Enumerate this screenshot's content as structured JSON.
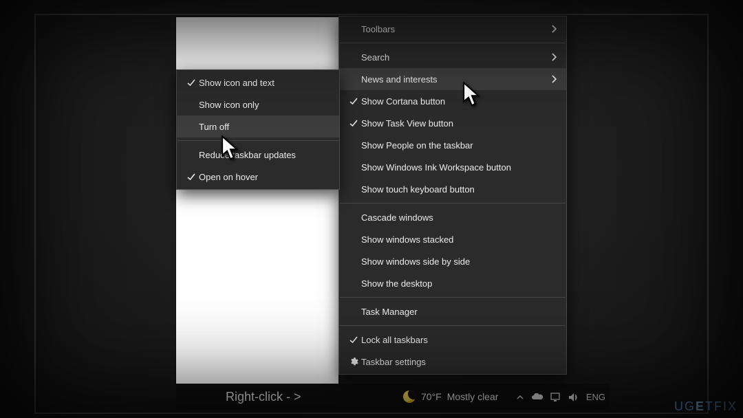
{
  "mainMenu": {
    "items": [
      {
        "label": "Toolbars",
        "arrow": true,
        "checked": false,
        "hover": false
      },
      {
        "sep": true
      },
      {
        "label": "Search",
        "arrow": true,
        "checked": false,
        "hover": false
      },
      {
        "label": "News and interests",
        "arrow": true,
        "checked": false,
        "hover": true
      },
      {
        "label": "Show Cortana button",
        "arrow": false,
        "checked": true,
        "hover": false
      },
      {
        "label": "Show Task View button",
        "arrow": false,
        "checked": true,
        "hover": false
      },
      {
        "label": "Show People on the taskbar",
        "arrow": false,
        "checked": false,
        "hover": false
      },
      {
        "label": "Show Windows Ink Workspace button",
        "arrow": false,
        "checked": false,
        "hover": false
      },
      {
        "label": "Show touch keyboard button",
        "arrow": false,
        "checked": false,
        "hover": false
      },
      {
        "sep": true
      },
      {
        "label": "Cascade windows",
        "arrow": false,
        "checked": false,
        "hover": false
      },
      {
        "label": "Show windows stacked",
        "arrow": false,
        "checked": false,
        "hover": false
      },
      {
        "label": "Show windows side by side",
        "arrow": false,
        "checked": false,
        "hover": false
      },
      {
        "label": "Show the desktop",
        "arrow": false,
        "checked": false,
        "hover": false
      },
      {
        "sep": true
      },
      {
        "label": "Task Manager",
        "arrow": false,
        "checked": false,
        "hover": false
      },
      {
        "sep": true
      },
      {
        "label": "Lock all taskbars",
        "arrow": false,
        "checked": true,
        "hover": false
      },
      {
        "label": "Taskbar settings",
        "arrow": false,
        "checked": false,
        "gear": true,
        "hover": false
      }
    ]
  },
  "subMenu": {
    "items": [
      {
        "label": "Show icon and text",
        "checked": true,
        "hover": false
      },
      {
        "label": "Show icon only",
        "checked": false,
        "hover": false
      },
      {
        "label": "Turn off",
        "checked": false,
        "hover": true
      },
      {
        "sep": true
      },
      {
        "label": "Reduce taskbar updates",
        "checked": false,
        "hover": false
      },
      {
        "label": "Open on hover",
        "checked": true,
        "hover": false
      }
    ]
  },
  "taskbar": {
    "hint": "Right-click - >",
    "weather": {
      "temp": "70°F",
      "desc": "Mostly clear"
    },
    "tray": {
      "lang": "ENG"
    }
  },
  "watermark": "UGETFIX"
}
